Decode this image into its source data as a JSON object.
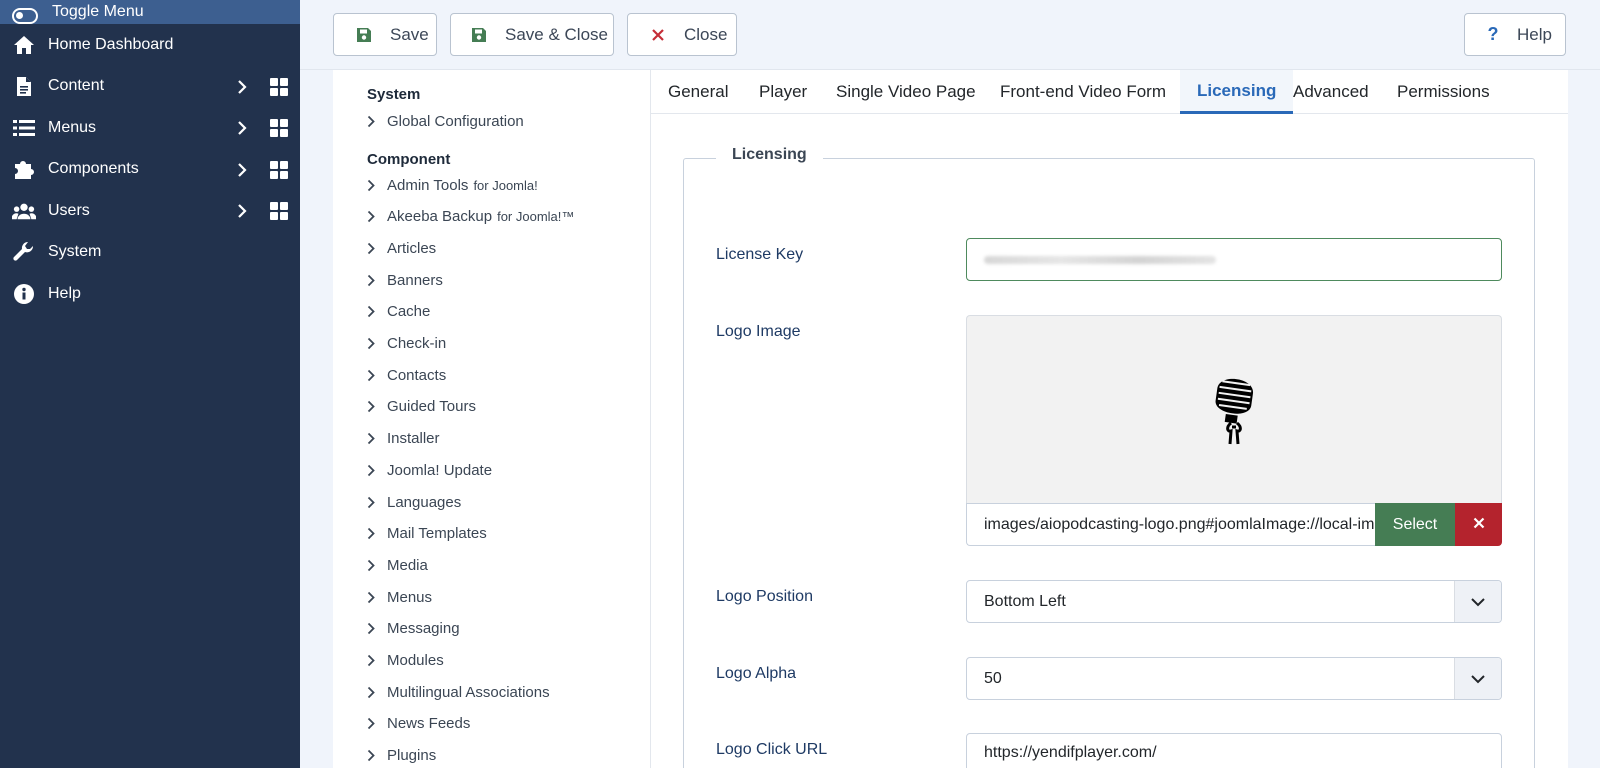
{
  "sidebar": {
    "toggle_label": "Toggle Menu",
    "items": [
      {
        "label": "Home Dashboard",
        "icon": "home-icon",
        "has_children": false
      },
      {
        "label": "Content",
        "icon": "file-icon",
        "has_children": true
      },
      {
        "label": "Menus",
        "icon": "list-icon",
        "has_children": true
      },
      {
        "label": "Components",
        "icon": "puzzle-icon",
        "has_children": true
      },
      {
        "label": "Users",
        "icon": "users-icon",
        "has_children": true
      },
      {
        "label": "System",
        "icon": "wrench-icon",
        "has_children": false
      },
      {
        "label": "Help",
        "icon": "info-icon",
        "has_children": false
      }
    ]
  },
  "toolbar": {
    "save_label": "Save",
    "save_close_label": "Save & Close",
    "close_label": "Close",
    "help_label": "Help"
  },
  "categories": {
    "system_heading": "System",
    "global_config": "Global Configuration",
    "component_heading": "Component",
    "items": [
      {
        "label": "Admin Tools",
        "suffix": "for Joomla!"
      },
      {
        "label": "Akeeba Backup",
        "suffix": "for Joomla!™"
      },
      {
        "label": "Articles",
        "suffix": ""
      },
      {
        "label": "Banners",
        "suffix": ""
      },
      {
        "label": "Cache",
        "suffix": ""
      },
      {
        "label": "Check-in",
        "suffix": ""
      },
      {
        "label": "Contacts",
        "suffix": ""
      },
      {
        "label": "Guided Tours",
        "suffix": ""
      },
      {
        "label": "Installer",
        "suffix": ""
      },
      {
        "label": "Joomla! Update",
        "suffix": ""
      },
      {
        "label": "Languages",
        "suffix": ""
      },
      {
        "label": "Mail Templates",
        "suffix": ""
      },
      {
        "label": "Media",
        "suffix": ""
      },
      {
        "label": "Menus",
        "suffix": ""
      },
      {
        "label": "Messaging",
        "suffix": ""
      },
      {
        "label": "Modules",
        "suffix": ""
      },
      {
        "label": "Multilingual Associations",
        "suffix": ""
      },
      {
        "label": "News Feeds",
        "suffix": ""
      },
      {
        "label": "Plugins",
        "suffix": ""
      }
    ]
  },
  "tabs": [
    {
      "label": "General",
      "active": false
    },
    {
      "label": "Player",
      "active": false
    },
    {
      "label": "Single Video Page",
      "active": false
    },
    {
      "label": "Front-end Video Form",
      "active": false
    },
    {
      "label": "Licensing",
      "active": true
    },
    {
      "label": "Advanced",
      "active": false
    },
    {
      "label": "Permissions",
      "active": false
    }
  ],
  "form": {
    "legend": "Licensing",
    "license_key_label": "License Key",
    "logo_image_label": "Logo Image",
    "logo_image_value": "images/aiopodcasting-logo.png#joomlaImage://local-images/aiopodcasting-logo.png",
    "select_label": "Select",
    "logo_position_label": "Logo Position",
    "logo_position_value": "Bottom Left",
    "logo_alpha_label": "Logo Alpha",
    "logo_alpha_value": "50",
    "logo_click_url_label": "Logo Click URL",
    "logo_click_url_value": "https://yendifplayer.com/"
  },
  "colors": {
    "sidebar_bg": "#22324d",
    "toggle_bg": "#3d5f90",
    "accent": "#2a69b8",
    "success": "#457d54",
    "danger": "#b4232d"
  }
}
